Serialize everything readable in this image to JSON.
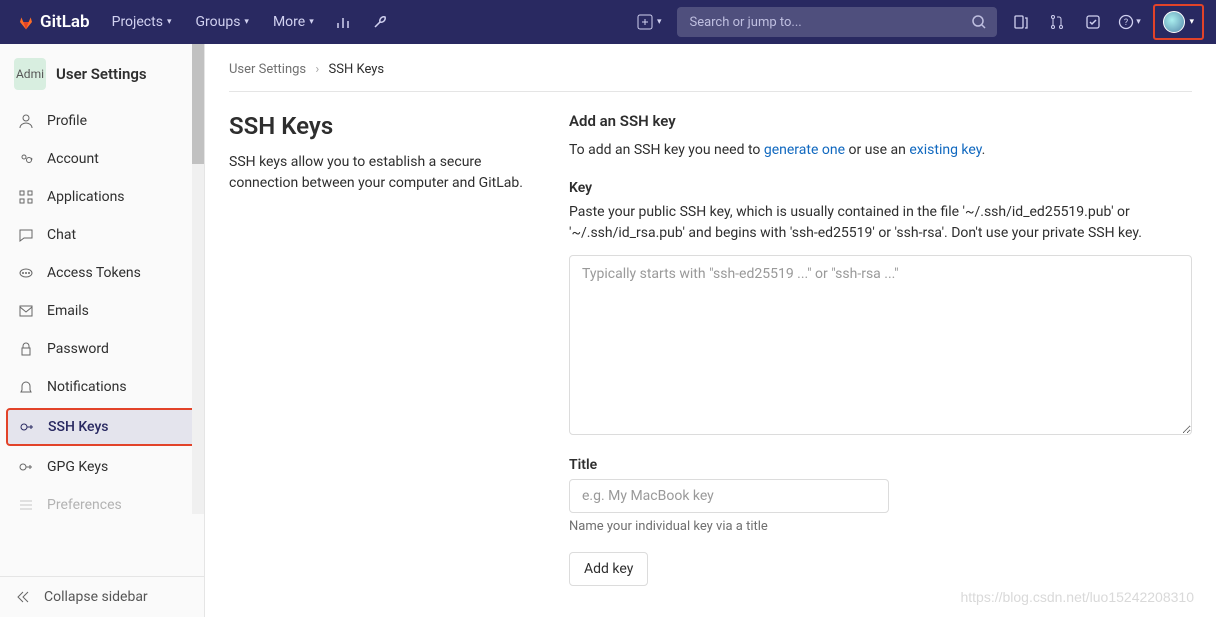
{
  "nav": {
    "brand": "GitLab",
    "items": [
      "Projects",
      "Groups",
      "More"
    ],
    "search_placeholder": "Search or jump to..."
  },
  "sidebar": {
    "avatar_label": "Admi",
    "title": "User Settings",
    "items": [
      {
        "icon": "profile",
        "label": "Profile"
      },
      {
        "icon": "account",
        "label": "Account"
      },
      {
        "icon": "apps",
        "label": "Applications"
      },
      {
        "icon": "chat",
        "label": "Chat"
      },
      {
        "icon": "token",
        "label": "Access Tokens"
      },
      {
        "icon": "mail",
        "label": "Emails"
      },
      {
        "icon": "lock",
        "label": "Password"
      },
      {
        "icon": "bell",
        "label": "Notifications"
      },
      {
        "icon": "key",
        "label": "SSH Keys"
      },
      {
        "icon": "key",
        "label": "GPG Keys"
      },
      {
        "icon": "pref",
        "label": "Preferences"
      }
    ],
    "collapse": "Collapse sidebar"
  },
  "breadcrumb": {
    "root": "User Settings",
    "current": "SSH Keys"
  },
  "page": {
    "title": "SSH Keys",
    "desc": "SSH keys allow you to establish a secure connection between your computer and GitLab."
  },
  "form": {
    "heading": "Add an SSH key",
    "intro_pre": "To add an SSH key you need to ",
    "intro_link1": "generate one",
    "intro_mid": " or use an ",
    "intro_link2": "existing key",
    "intro_post": ".",
    "key_label": "Key",
    "key_help": "Paste your public SSH key, which is usually contained in the file '~/.ssh/id_ed25519.pub' or '~/.ssh/id_rsa.pub' and begins with 'ssh-ed25519' or 'ssh-rsa'. Don't use your private SSH key.",
    "key_placeholder": "Typically starts with \"ssh-ed25519 ...\" or \"ssh-rsa ...\"",
    "title_label": "Title",
    "title_placeholder": "e.g. My MacBook key",
    "title_help": "Name your individual key via a title",
    "submit": "Add key"
  },
  "watermark": "https://blog.csdn.net/luo15242208310"
}
